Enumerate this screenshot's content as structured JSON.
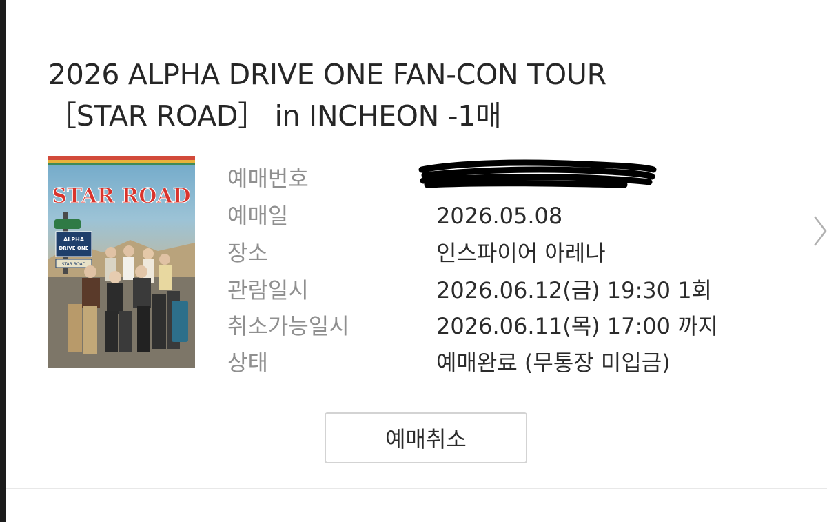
{
  "order": {
    "title_line1": "2026 ALPHA DRIVE ONE FAN-CON TOUR",
    "title_line2": "［STAR ROAD］ in INCHEON -1매",
    "poster": {
      "logo_text": "STAR ROAD",
      "sign_text_1": "ALPHA",
      "sign_text_2": "DRIVE ONE",
      "sign_text_3": "STAR ROAD"
    },
    "details": [
      {
        "label": "예매번호",
        "value": ""
      },
      {
        "label": "예매일",
        "value": "2026.05.08"
      },
      {
        "label": "장소",
        "value": "인스파이어 아레나"
      },
      {
        "label": "관람일시",
        "value": "2026.06.12(금) 19:30 1회"
      },
      {
        "label": "취소가능일시",
        "value": "2026.06.11(목) 17:00 까지"
      },
      {
        "label": "상태",
        "value": "예매완료 (무통장 미입금)"
      }
    ],
    "cancel_label": "예매취소"
  },
  "colors": {
    "label": "#8f8f8f",
    "value": "#2b2b2b",
    "button_border": "#d3d3d3",
    "divider": "#e8e8e8",
    "redaction": "#000000"
  },
  "icons": {
    "chevron": "chevron-right-icon"
  }
}
